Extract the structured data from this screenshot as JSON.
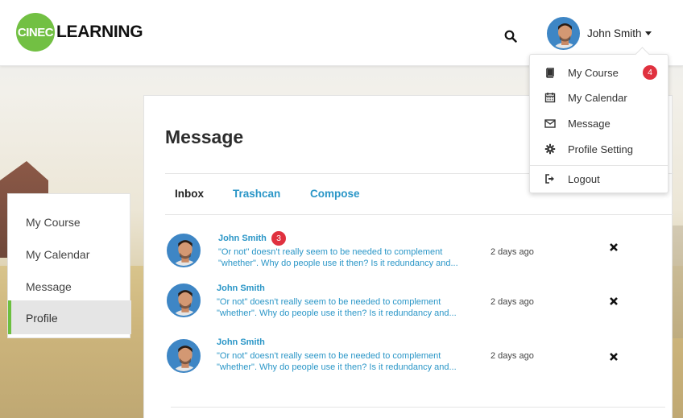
{
  "header": {
    "logo_circle_text": "CINEC",
    "logo_text": "LEARNING",
    "user_name": "John Smith"
  },
  "dropdown": {
    "items": [
      {
        "label": "My Course",
        "icon": "book-icon",
        "badge": "4"
      },
      {
        "label": "My Calendar",
        "icon": "calendar-icon"
      },
      {
        "label": "Message",
        "icon": "envelope-icon"
      },
      {
        "label": "Profile Setting",
        "icon": "gear-icon"
      },
      {
        "label": "Logout",
        "icon": "logout-icon"
      }
    ]
  },
  "main": {
    "title": "Message",
    "tabs": [
      {
        "label": "Inbox",
        "active": true
      },
      {
        "label": "Trashcan"
      },
      {
        "label": "Compose"
      }
    ],
    "messages": [
      {
        "sender": "John Smith",
        "badge": "3",
        "preview_line1": "\"Or not\" doesn't really seem to be needed to complement",
        "preview_line2": "\"whether\". Why do people use it then? Is it redundancy and...",
        "time": "2 days ago"
      },
      {
        "sender": "John Smith",
        "preview_line1": "\"Or not\" doesn't really seem to be needed to complement",
        "preview_line2": "\"whether\". Why do people use it then? Is it redundancy and...",
        "time": "2 days ago"
      },
      {
        "sender": "John Smith",
        "preview_line1": "\"Or not\" doesn't really seem to be needed to complement",
        "preview_line2": "\"whether\". Why do people use it then? Is it redundancy and...",
        "time": "2 days ago"
      }
    ]
  },
  "sidebar": {
    "items": [
      {
        "label": "My Course"
      },
      {
        "label": "My Calendar"
      },
      {
        "label": "Message"
      },
      {
        "label": "Profile",
        "active": true
      }
    ]
  },
  "colors": {
    "brand_green": "#72c043",
    "link_blue": "#2a96c7",
    "badge_red": "#e0313f",
    "active_bar": "#6cbf3f"
  }
}
